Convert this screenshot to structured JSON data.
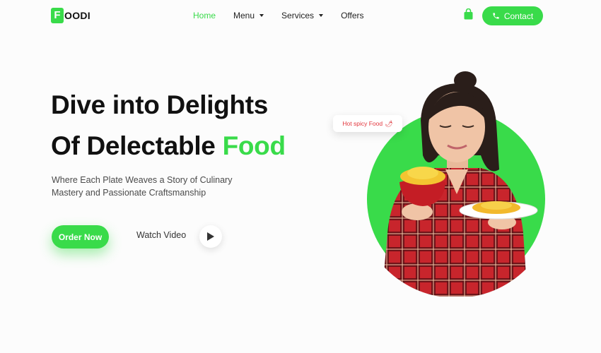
{
  "brand": {
    "logo_letter": "F",
    "logo_text": "OODI",
    "accent_color": "#39db4a"
  },
  "nav": {
    "items": [
      {
        "label": "Home",
        "active": true,
        "has_dropdown": false
      },
      {
        "label": "Menu",
        "active": false,
        "has_dropdown": true
      },
      {
        "label": "Services",
        "active": false,
        "has_dropdown": true
      },
      {
        "label": "Offers",
        "active": false,
        "has_dropdown": false
      }
    ],
    "cart_icon": "shopping-bag-icon",
    "contact_label": "Contact",
    "contact_icon": "phone-icon"
  },
  "hero": {
    "headline_line1": "Dive into Delights",
    "headline_line2_prefix": "Of Delectable ",
    "headline_line2_accent": "Food",
    "subtitle": "Where Each Plate Weaves a Story of Culinary Mastery and Passionate Craftsmanship",
    "order_label": "Order Now",
    "watch_label": "Watch Video",
    "play_icon": "play-icon",
    "badge_text": "Hot spicy Food",
    "badge_icon": "chili-icon"
  }
}
